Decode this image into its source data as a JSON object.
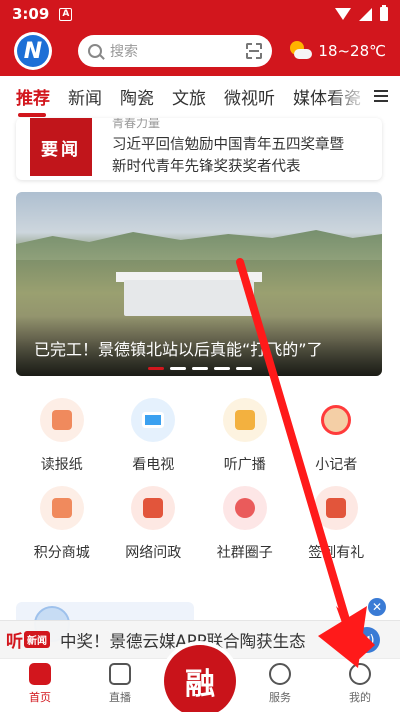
{
  "status_bar": {
    "time": "3:09",
    "notif_letter": "A"
  },
  "header": {
    "logo_letter": "N",
    "search_placeholder": "搜索",
    "weather_text": "18~28℃"
  },
  "tabs": [
    "推荐",
    "新闻",
    "陶瓷",
    "文旅",
    "微视听",
    "媒体看瓷"
  ],
  "news_card": {
    "badge": "要闻",
    "line_top": "青春力量",
    "line1": "习近平回信勉励中国青年五四奖章暨",
    "line2": "新时代青年先锋奖获奖者代表"
  },
  "banner": {
    "title": "已完工！景德镇北站以后真能“打飞的”了",
    "dots": 5,
    "active_dot": 0
  },
  "grid": [
    {
      "label": "读报纸",
      "icon": "newspaper-icon",
      "color": "#f08a5d"
    },
    {
      "label": "看电视",
      "icon": "tv-icon",
      "color": "#3aa0f0"
    },
    {
      "label": "听广播",
      "icon": "radio-icon",
      "color": "#f3b13f"
    },
    {
      "label": "小记者",
      "icon": "reporter-icon",
      "color": "#ff3b3b"
    },
    {
      "label": "积分商城",
      "icon": "shop-bag-icon",
      "color": "#f08a5d"
    },
    {
      "label": "网络问政",
      "icon": "government-icon",
      "color": "#e2553b"
    },
    {
      "label": "社群圈子",
      "icon": "community-icon",
      "color": "#ea5b5b"
    },
    {
      "label": "签到有礼",
      "icon": "calendar-check-icon",
      "color": "#e2553b"
    }
  ],
  "audio_bar": {
    "logo_text": "听",
    "logo_sub": "新闻",
    "text": "中奖！景德云媒APP联合陶获生态"
  },
  "bottom_nav": {
    "items": [
      "首页",
      "直播",
      "",
      "服务",
      "我的"
    ],
    "center_label": "融"
  },
  "colors": {
    "brand_red": "#d2161d",
    "accent_blue": "#3a7bd5"
  }
}
